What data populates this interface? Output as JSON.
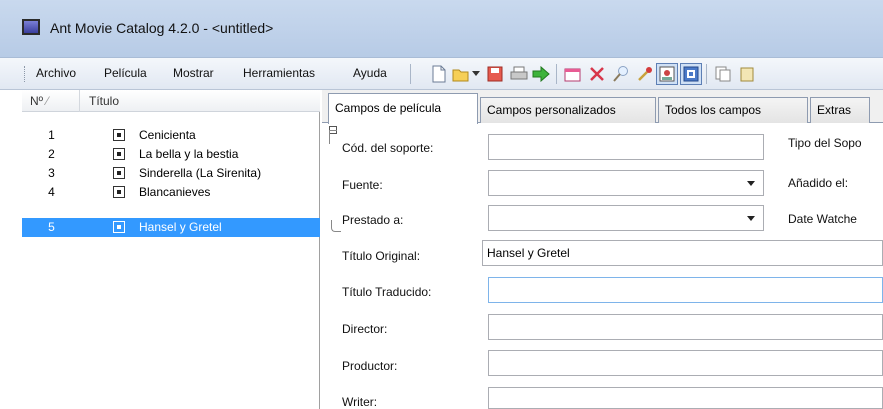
{
  "window": {
    "title": "Ant Movie Catalog 4.2.0 - <untitled>"
  },
  "menu": [
    "Archivo",
    "Película",
    "Mostrar",
    "Herramientas",
    "Ayuda"
  ],
  "toolbar": [
    {
      "name": "new-file-icon",
      "glyph": "🗋"
    },
    {
      "name": "open-folder-icon",
      "glyph": "📂"
    },
    {
      "name": "dropdown-icon",
      "glyph": "▾"
    },
    {
      "name": "save-icon",
      "glyph": "💾"
    },
    {
      "name": "print-icon",
      "glyph": "🖶"
    },
    {
      "name": "add-movie-icon",
      "glyph": "➡"
    },
    {
      "name": "new-window-icon",
      "glyph": "🗔"
    },
    {
      "name": "delete-icon",
      "glyph": "✕"
    },
    {
      "name": "search-icon",
      "glyph": "🔍"
    },
    {
      "name": "tools-icon",
      "glyph": "🔧"
    },
    {
      "name": "picture-icon",
      "glyph": "🖼"
    },
    {
      "name": "picture-alt-icon",
      "glyph": "🖼"
    },
    {
      "name": "copy-icon",
      "glyph": "⎘"
    }
  ],
  "list": {
    "columns": {
      "no": "Nº",
      "title": "Título"
    },
    "rows": [
      {
        "no": "1",
        "title": "Cenicienta"
      },
      {
        "no": "2",
        "title": "La bella y la bestia"
      },
      {
        "no": "3",
        "title": "Sinderella (La Sirenita)"
      },
      {
        "no": "4",
        "title": "Blancanieves"
      },
      {
        "no": "5",
        "title": "Hansel y Gretel"
      }
    ],
    "selected_index": 4
  },
  "tabs": [
    "Campos de película",
    "Campos personalizados",
    "Todos los campos",
    "Extras"
  ],
  "form": {
    "media_label": "Cód. del soporte:",
    "media_type_label": "Tipo del Sopo",
    "source_label": "Fuente:",
    "added_label": "Añadido el:",
    "borrower_label": "Prestado a:",
    "date_watched_label": "Date Watche",
    "original_title_label": "Título Original:",
    "original_title_value": "Hansel y Gretel",
    "translated_title_label": "Título Traducido:",
    "director_label": "Director:",
    "producer_label": "Productor:",
    "writer_label": "Writer:"
  }
}
